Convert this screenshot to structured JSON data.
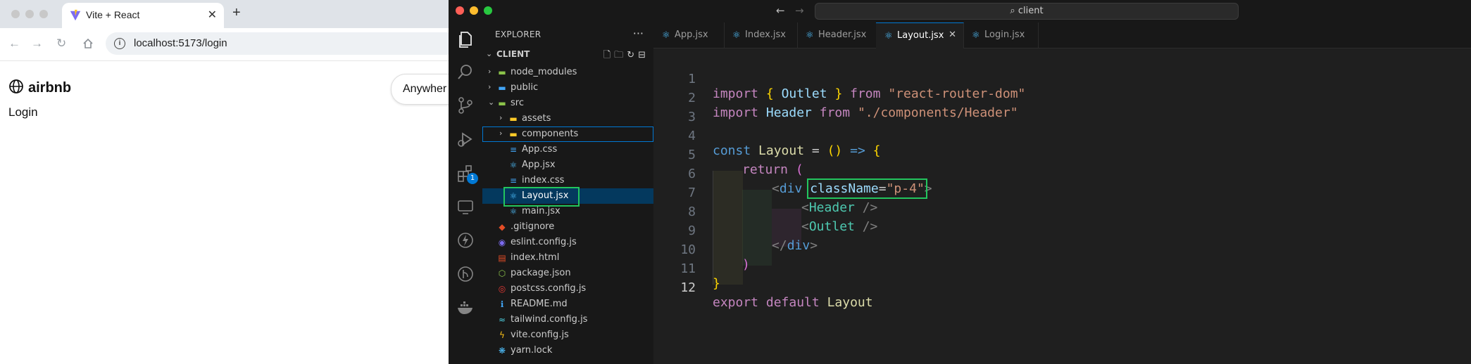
{
  "browser": {
    "tab_title": "Vite + React",
    "url": "localhost:5173/login",
    "page": {
      "brand": "airbnb",
      "text": "Login",
      "search_pill": "Anywher"
    }
  },
  "vscode": {
    "search": "client",
    "explorer": {
      "header": "EXPLORER",
      "project": "CLIENT",
      "items": [
        {
          "label": "node_modules",
          "kind": "folder",
          "icon": "folder-icon"
        },
        {
          "label": "public",
          "kind": "folder",
          "icon": "folder-icon"
        },
        {
          "label": "src",
          "kind": "folder-open",
          "icon": "folder-open-icon"
        },
        {
          "label": "assets",
          "kind": "folder",
          "icon": "folder-icon"
        },
        {
          "label": "components",
          "kind": "folder",
          "icon": "folder-icon"
        },
        {
          "label": "App.css",
          "kind": "css",
          "icon": "css-file-icon"
        },
        {
          "label": "App.jsx",
          "kind": "react",
          "icon": "react-file-icon"
        },
        {
          "label": "index.css",
          "kind": "css",
          "icon": "css-file-icon"
        },
        {
          "label": "Layout.jsx",
          "kind": "react",
          "icon": "react-file-icon"
        },
        {
          "label": "main.jsx",
          "kind": "react",
          "icon": "react-file-icon"
        },
        {
          "label": ".gitignore",
          "kind": "git",
          "icon": "git-file-icon"
        },
        {
          "label": "eslint.config.js",
          "kind": "eslint",
          "icon": "eslint-file-icon"
        },
        {
          "label": "index.html",
          "kind": "html",
          "icon": "html-file-icon"
        },
        {
          "label": "package.json",
          "kind": "json",
          "icon": "npm-file-icon"
        },
        {
          "label": "postcss.config.js",
          "kind": "postcss",
          "icon": "postcss-file-icon"
        },
        {
          "label": "README.md",
          "kind": "info",
          "icon": "info-file-icon"
        },
        {
          "label": "tailwind.config.js",
          "kind": "tailwind",
          "icon": "tailwind-file-icon"
        },
        {
          "label": "vite.config.js",
          "kind": "vite",
          "icon": "vite-file-icon"
        },
        {
          "label": "yarn.lock",
          "kind": "yarn",
          "icon": "yarn-file-icon"
        }
      ]
    },
    "tabs": [
      {
        "label": "App.jsx",
        "active": false
      },
      {
        "label": "Index.jsx",
        "active": false
      },
      {
        "label": "Header.jsx",
        "active": false
      },
      {
        "label": "Layout.jsx",
        "active": true
      },
      {
        "label": "Login.jsx",
        "active": false
      }
    ],
    "activity_badge": "1",
    "code": {
      "line_numbers": [
        "1",
        "2",
        "3",
        "4",
        "5",
        "6",
        "7",
        "8",
        "9",
        "10",
        "11",
        "12"
      ],
      "l1": {
        "kw": "import",
        "b1": "{",
        "id": "Outlet",
        "b2": "}",
        "from": "from",
        "str": "\"react-router-dom\""
      },
      "l2": {
        "kw": "import",
        "id": "Header",
        "from": "from",
        "str": "\"./components/Header\""
      },
      "l4": {
        "kw": "const",
        "id": "Layout",
        "eq": "=",
        "paren": "()",
        "arrow": "=>",
        "brace": "{"
      },
      "l5": {
        "kw": "return",
        "paren": "("
      },
      "l6": {
        "open": "<",
        "tag": "div",
        "attr": "className",
        "eq": "=",
        "val": "\"p-4\"",
        "close": ">"
      },
      "l7": {
        "open": "<",
        "tag": "Header",
        "close": "/>"
      },
      "l8": {
        "open": "<",
        "tag": "Outlet",
        "close": "/>"
      },
      "l9": {
        "open": "</",
        "tag": "div",
        "close": ">"
      },
      "l10": {
        "paren": ")"
      },
      "l11": {
        "brace": "}"
      },
      "l12": {
        "kw1": "export",
        "kw2": "default",
        "id": "Layout"
      }
    }
  }
}
